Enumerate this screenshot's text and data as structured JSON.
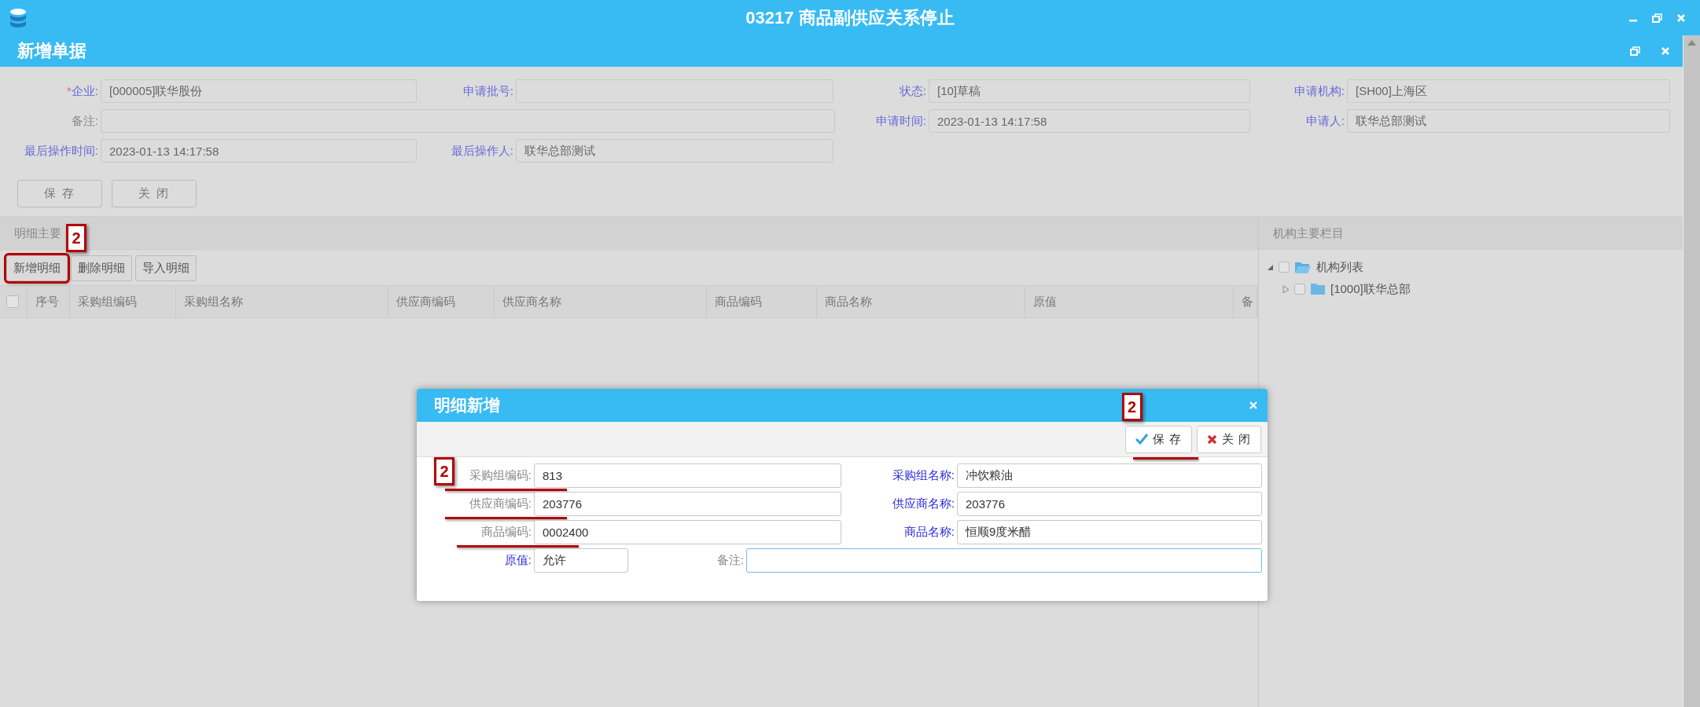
{
  "window": {
    "title": "03217 商品副供应关系停止"
  },
  "document": {
    "title": "新增单据",
    "fields": [
      {
        "required_mark": "*",
        "label": "企业:",
        "highlighted": true,
        "kind": "text",
        "value": "[000005]联华股份"
      },
      {
        "label": "申请批号:",
        "highlighted": true,
        "kind": "text"
      },
      {
        "label": "状态:",
        "highlighted": true,
        "kind": "text",
        "value": "[10]草稿"
      },
      {
        "label": "申请机构:",
        "highlighted": true,
        "kind": "text",
        "value": "[SH00]上海区"
      },
      {
        "label": "备注:",
        "highlighted": false,
        "kind": "memo"
      },
      {
        "label": "申请时间:",
        "highlighted": true,
        "kind": "text",
        "value": "2023-01-13 14:17:58"
      },
      {
        "label": "申请人:",
        "highlighted": true,
        "kind": "text",
        "value": "联华总部测试"
      },
      {
        "label": "最后操作时间:",
        "highlighted": true,
        "kind": "text",
        "value": "2023-01-13 14:17:58"
      },
      {
        "label": "最后操作人:",
        "highlighted": true,
        "kind": "text",
        "value": "联华总部测试"
      }
    ],
    "buttons": [
      "保 存",
      "关 闭"
    ]
  },
  "detail": {
    "title": "明细主要",
    "toolbar": [
      {
        "label": "新增明细",
        "framed": true,
        "callout": "2"
      },
      {
        "label": "删除明细",
        "framed": false
      },
      {
        "label": "导入明细",
        "framed": false
      }
    ],
    "select_all_checked": false,
    "columns": [
      "序号",
      "采购组编码",
      "采购组名称",
      "供应商编码",
      "供应商名称",
      "商品编码",
      "商品名称",
      "原值",
      "备"
    ]
  },
  "tree": {
    "title": "机构主要栏目",
    "nodes": [
      {
        "label": "机构列表",
        "expanded": true,
        "checked": false,
        "children": [
          {
            "label": "[1000]联华总部",
            "expanded": false,
            "checked": false
          }
        ]
      }
    ]
  },
  "dialog": {
    "title": "明细新增",
    "callout": "2",
    "buttons": [
      {
        "label": "保 存",
        "underlined": true,
        "callout": "2"
      },
      {
        "label": "关 闭",
        "underlined": false
      }
    ],
    "fields": [
      {
        "label": "采购组编码:",
        "highlighted": false,
        "underlined": true,
        "focused": false,
        "kind": "text",
        "value": "813"
      },
      {
        "label": "采购组名称:",
        "highlighted": true,
        "underlined": false,
        "focused": false,
        "kind": "text",
        "value": "冲饮粮油"
      },
      {
        "label": "供应商编码:",
        "highlighted": false,
        "underlined": true,
        "focused": false,
        "kind": "text",
        "value": "203776"
      },
      {
        "label": "供应商名称:",
        "highlighted": true,
        "underlined": false,
        "focused": false,
        "kind": "text",
        "value": "203776"
      },
      {
        "label": "商品编码:",
        "highlighted": false,
        "underlined": true,
        "focused": false,
        "kind": "text",
        "value": "0002400"
      },
      {
        "label": "商品名称:",
        "highlighted": true,
        "underlined": false,
        "focused": false,
        "kind": "text",
        "value": "恒顺9度米醋"
      },
      {
        "label": "原值:",
        "highlighted": true,
        "underlined": false,
        "focused": false,
        "kind": "short",
        "value": "允许"
      },
      {
        "label": "备注:",
        "highlighted": false,
        "underlined": false,
        "focused": true,
        "kind": "memo"
      }
    ]
  }
}
